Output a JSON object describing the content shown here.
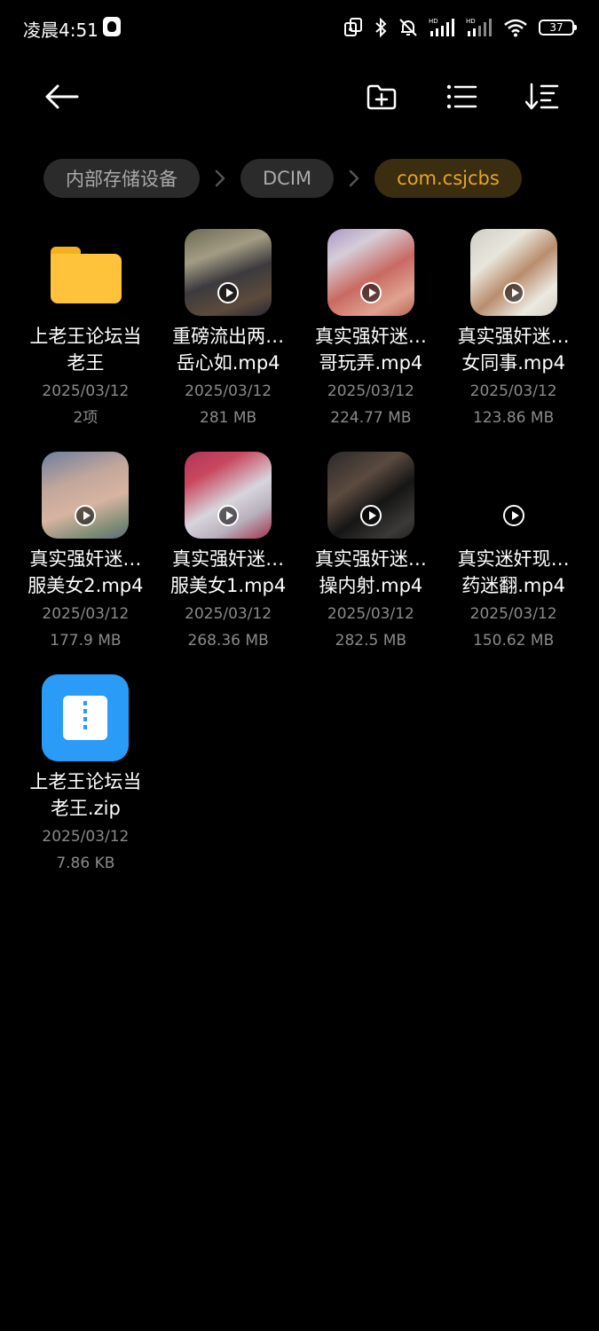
{
  "status_bar": {
    "time": "凌晨4:51",
    "battery": "37",
    "icons": [
      "qq-icon",
      "screen-record-icon",
      "bluetooth-icon",
      "mute-bell-icon",
      "hd-signal-icon",
      "hd-signal-2-icon",
      "wifi-icon",
      "battery-icon"
    ]
  },
  "toolbar": {
    "icons": [
      "back-arrow-icon",
      "new-folder-icon",
      "list-view-icon",
      "sort-icon"
    ]
  },
  "breadcrumbs": [
    {
      "label": "内部存储设备",
      "active": false
    },
    {
      "label": "DCIM",
      "active": false
    },
    {
      "label": "com.csjcbs",
      "active": true
    }
  ],
  "colors": {
    "background": "#000000",
    "accent": "#e6a42a",
    "folder": "#ffc23a",
    "zip": "#2a9cf7"
  },
  "files": [
    {
      "type": "folder",
      "name_line1": "上老王论坛当",
      "name_line2": "老王",
      "date": "2025/03/12",
      "meta": "2项"
    },
    {
      "type": "video",
      "name_line1": "重磅流出两…",
      "name_line2": "岳心如.mp4",
      "date": "2025/03/12",
      "meta": "281 MB"
    },
    {
      "type": "video",
      "name_line1": "真实强奸迷…",
      "name_line2": "哥玩弄.mp4",
      "date": "2025/03/12",
      "meta": "224.77 MB"
    },
    {
      "type": "video",
      "name_line1": "真实强奸迷…",
      "name_line2": "女同事.mp4",
      "date": "2025/03/12",
      "meta": "123.86 MB"
    },
    {
      "type": "video",
      "name_line1": "真实强奸迷…",
      "name_line2": "服美女2.mp4",
      "date": "2025/03/12",
      "meta": "177.9 MB"
    },
    {
      "type": "video",
      "name_line1": "真实强奸迷…",
      "name_line2": "服美女1.mp4",
      "date": "2025/03/12",
      "meta": "268.36 MB"
    },
    {
      "type": "video",
      "name_line1": "真实强奸迷…",
      "name_line2": "操内射.mp4",
      "date": "2025/03/12",
      "meta": "282.5 MB"
    },
    {
      "type": "video",
      "name_line1": "真实迷奸现…",
      "name_line2": "药迷翻.mp4",
      "date": "2025/03/12",
      "meta": "150.62 MB"
    },
    {
      "type": "zip",
      "name_line1": "上老王论坛当",
      "name_line2": "老王.zip",
      "date": "2025/03/12",
      "meta": "7.86 KB"
    }
  ]
}
